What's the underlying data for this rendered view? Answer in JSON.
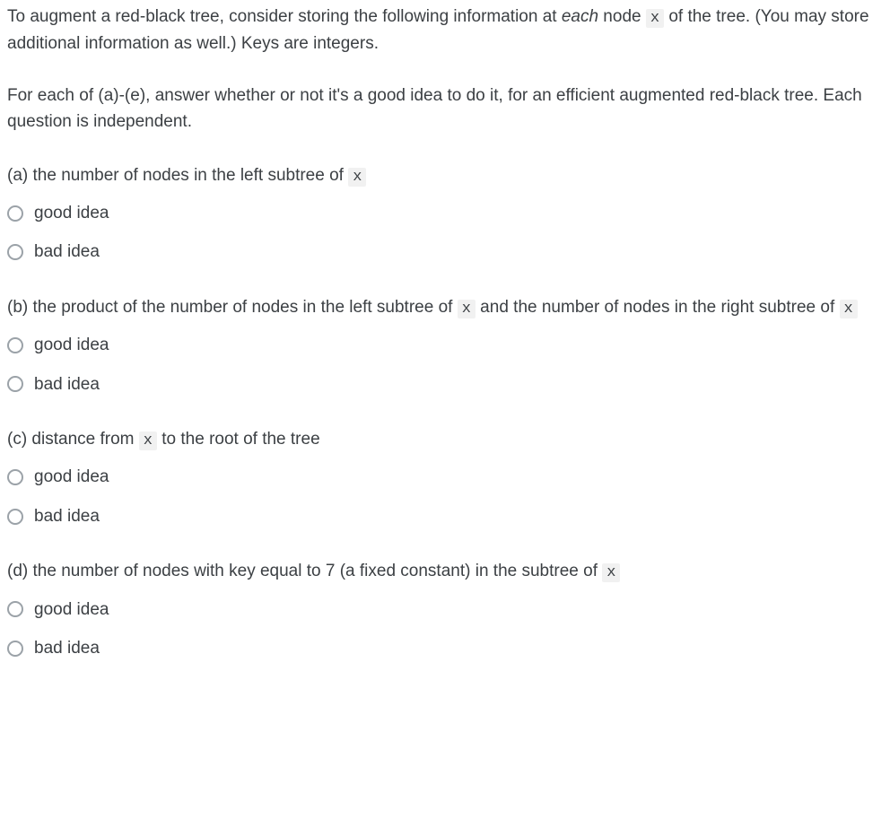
{
  "intro_parts": [
    "To augment a red-black tree, consider storing the following information at ",
    "each",
    " node ",
    "x",
    " of the tree.  (You may store additional information as well.)  Keys are integers."
  ],
  "sub_intro": "For each of (a)-(e), answer whether or not it's a good idea to do it, for an efficient augmented red-black tree.  Each question is independent.",
  "code_token": "x",
  "options": {
    "good": "good idea",
    "bad": "bad idea"
  },
  "questions": {
    "a": {
      "prefix": "(a) the number of nodes in the left subtree of ",
      "suffix": ""
    },
    "b": {
      "prefix": "(b) the product of the number of nodes in the left subtree of ",
      "mid": " and the number of nodes in the right subtree of ",
      "suffix": ""
    },
    "c": {
      "prefix": "(c) distance from ",
      "suffix": " to the root of the tree"
    },
    "d": {
      "prefix": "(d) the number of nodes with key equal to 7 (a fixed constant) in the subtree of ",
      "suffix": ""
    }
  }
}
